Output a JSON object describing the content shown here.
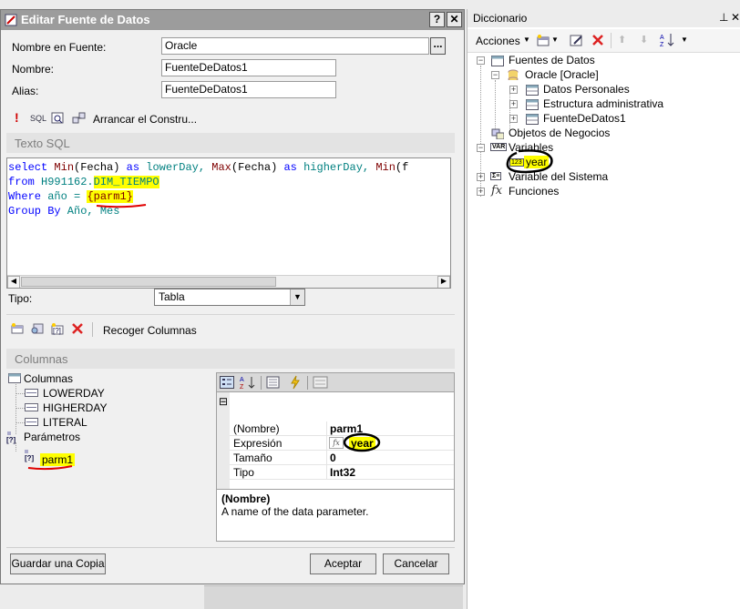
{
  "dialog": {
    "title": "Editar Fuente de Datos",
    "help_btn": "?",
    "close_btn": "✕",
    "source_name_label": "Nombre en Fuente:",
    "source_name_value": "Oracle",
    "browse_btn": "...",
    "name_label": "Nombre:",
    "name_value": "FuenteDeDatos1",
    "alias_label": "Alias:",
    "alias_value": "FuenteDeDatos1",
    "toolbar": {
      "sql_label": "SQL",
      "builder_label": "Arrancar el Constru..."
    },
    "sql_section": "Texto SQL",
    "sql_lines": [
      "select Min(Fecha) as lowerDay, Max(Fecha) as higherDay, Min(f",
      "from H991162.DIM_TIEMPO",
      "Where año = {parm1}",
      "Group By Año, Mes"
    ],
    "sql_tokens": {
      "l0": {
        "select": "select",
        "min1": "Min",
        "a1": "(Fecha) ",
        "as1": "as",
        "v1": " lowerDay, ",
        "max": "Max",
        "a2": "(Fecha) ",
        "as2": "as",
        "v2": " higherDay, ",
        "min2": "Min",
        "a3": "(f"
      },
      "l1": {
        "from": "from",
        "schema": " H991162.",
        "table": "DIM_TIEMPO"
      },
      "l2": {
        "where": "Where",
        "rest": " año = ",
        "param": "{parm1}"
      },
      "l3": {
        "group": "Group By",
        "rest": " Año, Mes"
      }
    },
    "type_label": "Tipo:",
    "type_value": "Tabla",
    "collect_columns": "Recoger Columnas",
    "columns_section": "Columnas",
    "tree": {
      "columns_node": "Columnas",
      "columns": [
        "LOWERDAY",
        "HIGHERDAY",
        "LITERAL"
      ],
      "params_node": "Parámetros",
      "params": [
        "parm1"
      ]
    },
    "properties": [
      {
        "key": "(Nombre)",
        "value": "parm1"
      },
      {
        "key": "Expresión",
        "value": "year"
      },
      {
        "key": "Tamaño",
        "value": "0"
      },
      {
        "key": "Tipo",
        "value": "Int32"
      }
    ],
    "fx_glyph": "fx",
    "collapse_glyph": "⊟",
    "description_title": "(Nombre)",
    "description_text": "A name of the data parameter.",
    "save_copy_btn": "Guardar una Copia",
    "ok_btn": "Aceptar",
    "cancel_btn": "Cancelar"
  },
  "dictionary": {
    "title": "Diccionario",
    "pin": "⊥",
    "close": "✕",
    "actions_label": "Acciones",
    "nodes": {
      "data_sources": "Fuentes de Datos",
      "oracle": "Oracle [Oracle]",
      "personal": "Datos Personales",
      "admin": "Estructura administrativa",
      "fds1": "FuenteDeDatos1",
      "business": "Objetos de Negocios",
      "variables": "Variables",
      "year": "year",
      "system_vars": "Variable del Sistema",
      "functions": "Funciones"
    },
    "var_badge": "VAR",
    "num_badge": "123",
    "sys_badge": "Σ≡",
    "fx_badge": "fx"
  },
  "colors": {
    "highlight": "#ffff00",
    "annotation": "#000000",
    "underline": "#e00000",
    "sql_keyword": "#0000ff",
    "sql_function": "#7f0000",
    "sql_table": "#008080"
  }
}
